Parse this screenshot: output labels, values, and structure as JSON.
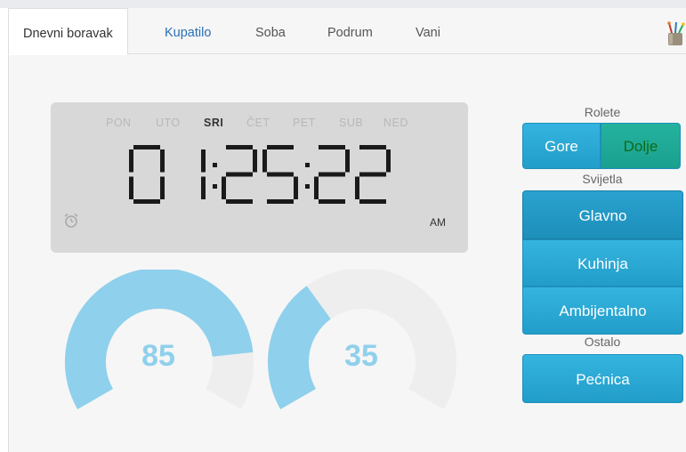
{
  "tabs": [
    {
      "label": "Dnevni boravak",
      "active": true
    },
    {
      "label": "Kupatilo",
      "active": false
    },
    {
      "label": "Soba",
      "active": false
    },
    {
      "label": "Podrum",
      "active": false
    },
    {
      "label": "Vani",
      "active": false
    }
  ],
  "clock": {
    "days": [
      "PON",
      "UTO",
      "SRI",
      "ČET",
      "PET",
      "SUB",
      "NED"
    ],
    "active_day": "SRI",
    "time": "01:25:22",
    "period": "AM"
  },
  "gauges": [
    {
      "value": "85",
      "fraction": 0.85
    },
    {
      "value": "35",
      "fraction": 0.35
    }
  ],
  "rolete": {
    "label": "Rolete",
    "up": "Gore",
    "down": "Dolje"
  },
  "svjetla": {
    "label": "Svijetla",
    "items": [
      "Glavno",
      "Kuhinja",
      "Ambijentalno"
    ]
  },
  "ostalo": {
    "label": "Ostalo",
    "items": [
      "Pećnica"
    ]
  },
  "colors": {
    "accent": "#2aa7d5",
    "gauge_fill": "#8fd0ec",
    "gauge_track": "#eeeeee",
    "lcd_background": "#d8d8d8",
    "dolje_text": "#0e6b1a"
  },
  "icons": {
    "tab_bar_right": "paint-brush-cup-icon",
    "clock_alarm": "alarm-clock-icon"
  }
}
